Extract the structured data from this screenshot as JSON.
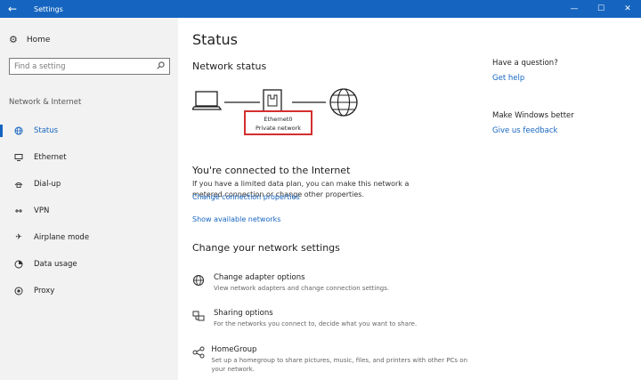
{
  "window": {
    "title": "Settings",
    "back_glyph": "←",
    "controls": [
      "—",
      "☐",
      "✕"
    ]
  },
  "sidebar": {
    "home_label": "Home",
    "search_placeholder": "Find a setting",
    "section_label": "Network & Internet",
    "items": [
      {
        "label": "Status",
        "icon": "status-icon",
        "active": true
      },
      {
        "label": "Ethernet",
        "icon": "ethernet-icon",
        "active": false
      },
      {
        "label": "Dial-up",
        "icon": "dialup-icon",
        "active": false
      },
      {
        "label": "VPN",
        "icon": "vpn-icon",
        "active": false
      },
      {
        "label": "Airplane mode",
        "icon": "airplane-icon",
        "active": false
      },
      {
        "label": "Data usage",
        "icon": "data-usage-icon",
        "active": false
      },
      {
        "label": "Proxy",
        "icon": "proxy-icon",
        "active": false
      }
    ]
  },
  "main": {
    "title": "Status",
    "network_status_heading": "Network status",
    "adapter_name": "Ethernet0",
    "network_type": "Private network",
    "connected_heading": "You're connected to the Internet",
    "connected_desc": "If you have a limited data plan, you can make this network a metered connection or change other properties.",
    "link_change_props": "Change connection properties",
    "link_show_networks": "Show available networks",
    "change_heading": "Change your network settings",
    "options": [
      {
        "title": "Change adapter options",
        "desc": "View network adapters and change connection settings.",
        "icon": "adapter-icon"
      },
      {
        "title": "Sharing options",
        "desc": "For the networks you connect to, decide what you want to share.",
        "icon": "sharing-icon"
      },
      {
        "title": "HomeGroup",
        "desc": "Set up a homegroup to share pictures, music, files, and printers with other PCs on your network.",
        "icon": "homegroup-icon"
      }
    ]
  },
  "right_panel": {
    "question_heading": "Have a question?",
    "get_help": "Get help",
    "better_heading": "Make Windows better",
    "feedback": "Give us feedback"
  },
  "colors": {
    "accent": "#1565c0",
    "highlight_box": "#d32f2f",
    "sidebar_bg": "#f2f2f2"
  }
}
